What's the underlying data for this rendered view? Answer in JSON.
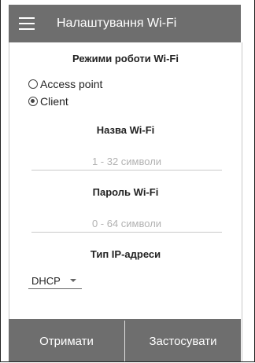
{
  "appbar": {
    "title": "Налаштування Wi-Fi"
  },
  "wifi_mode": {
    "title": "Режими роботи Wi-Fi",
    "options": [
      {
        "label": "Access point",
        "selected": false
      },
      {
        "label": "Client",
        "selected": true
      }
    ]
  },
  "ssid": {
    "label": "Назва Wi-Fi",
    "placeholder": "1 - 32 символи",
    "value": ""
  },
  "password": {
    "label": "Пароль Wi-Fi",
    "placeholder": "0 - 64 символи",
    "value": ""
  },
  "ip_type": {
    "label": "Тип IP-адреси",
    "selected": "DHCP"
  },
  "buttons": {
    "get": "Отримати",
    "apply": "Застосувати"
  }
}
